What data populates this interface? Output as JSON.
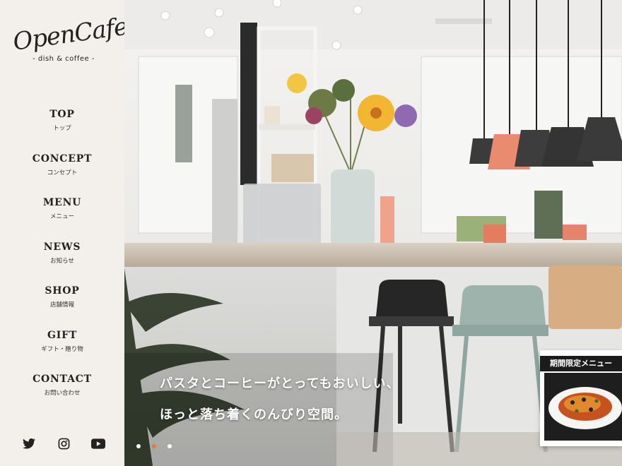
{
  "brand": {
    "logo": "OpenCafe",
    "tagline": "- dish & coffee -"
  },
  "nav": [
    {
      "en": "TOP",
      "jp": "トップ"
    },
    {
      "en": "CONCEPT",
      "jp": "コンセプト"
    },
    {
      "en": "MENU",
      "jp": "メニュー"
    },
    {
      "en": "NEWS",
      "jp": "お知らせ"
    },
    {
      "en": "SHOP",
      "jp": "店舗情報"
    },
    {
      "en": "GIFT",
      "jp": "ギフト・贈り物"
    },
    {
      "en": "CONTACT",
      "jp": "お問い合わせ"
    }
  ],
  "social": [
    "twitter-icon",
    "instagram-icon",
    "youtube-icon"
  ],
  "hero": {
    "line1": "パスタとコーヒーがとってもおいしい、",
    "line2": "ほっと落ち着くのんびり空間。",
    "slides": 3,
    "active_slide": 2
  },
  "promo": {
    "label": "期間限定メニュー"
  },
  "colors": {
    "sidebar_bg": "#f3f0eb",
    "accent": "#e27a3f",
    "text": "#222222"
  }
}
